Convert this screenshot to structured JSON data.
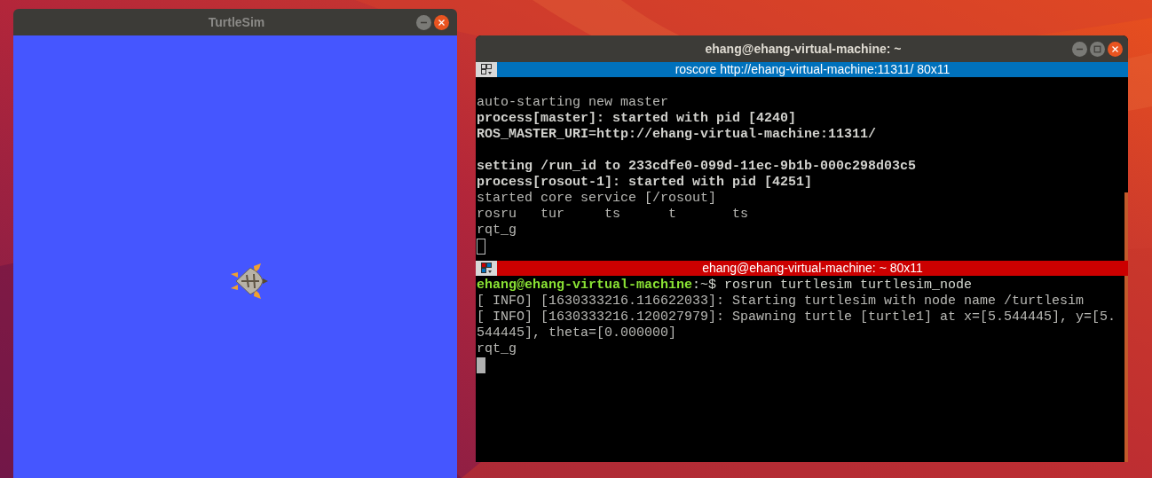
{
  "windows": [
    {
      "kind": "turtlesim",
      "title": "TurtleSim"
    },
    {
      "kind": "terminal",
      "title": "ehang@ehang-virtual-machine: ~",
      "panes": [
        {
          "header": "roscore http://ehang-virtual-machine:11311/ 80x11",
          "active": false,
          "lines": [
            {
              "kind": "blank"
            },
            {
              "kind": "normal",
              "text": "auto-starting new master"
            },
            {
              "kind": "bold",
              "text": "process[master]: started with pid [4240]"
            },
            {
              "kind": "bold",
              "text": "ROS_MASTER_URI=http://ehang-virtual-machine:11311/"
            },
            {
              "kind": "blank"
            },
            {
              "kind": "bold",
              "text": "setting /run_id to 233cdfe0-099d-11ec-9b1b-000c298d03c5"
            },
            {
              "kind": "bold",
              "text": "process[rosout-1]: started with pid [4251]"
            },
            {
              "kind": "normal",
              "text": "started core service [/rosout]"
            },
            {
              "kind": "normal",
              "text": "rosru   tur     ts      t       ts"
            },
            {
              "kind": "normal",
              "text": "rqt_g"
            }
          ]
        },
        {
          "header": "ehang@ehang-virtual-machine: ~ 80x11",
          "active": true,
          "lines": [
            {
              "kind": "prompt",
              "user": "ehang@ehang-virtual-machine",
              "text": ":~$ rosrun turtlesim turtlesim_node"
            },
            {
              "kind": "normal",
              "text": "[ INFO] [1630333216.116622033]: Starting turtlesim with node name /turtlesim"
            },
            {
              "kind": "normal",
              "text": "[ INFO] [1630333216.120027979]: Spawning turtle [turtle1] at x=[5.544445], y=[5."
            },
            {
              "kind": "normal",
              "text": "544445], theta=[0.000000]"
            },
            {
              "kind": "normal",
              "text": "rqt_g"
            }
          ]
        }
      ]
    }
  ]
}
